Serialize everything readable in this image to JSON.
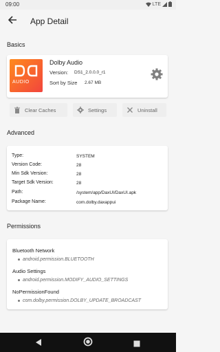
{
  "status": {
    "time": "09:00",
    "network": "LTE"
  },
  "toolbar": {
    "title": "App Detail"
  },
  "basics": {
    "section_title": "Basics",
    "app_name": "Dolby Audio",
    "version_label": "Version:",
    "version_value": "DS1_2.0.0.0_r1",
    "sort_label": "Sort by Size",
    "size_value": "2.67 MB",
    "icon_text": "AUDIO"
  },
  "actions": {
    "clear_caches": "Clear Caches",
    "settings": "Settings",
    "uninstall": "Uninstall"
  },
  "advanced": {
    "section_title": "Advanced",
    "rows": [
      {
        "label": "Type:",
        "value": "SYSTEM"
      },
      {
        "label": "Version Code:",
        "value": "28"
      },
      {
        "label": "Min Sdk Version:",
        "value": "28"
      },
      {
        "label": "Target Sdk Version:",
        "value": "28"
      },
      {
        "label": "Path:",
        "value": "/system/app/DaxUI/DaxUI.apk"
      },
      {
        "label": "Package Name:",
        "value": "com.dolby.daxappui"
      }
    ]
  },
  "permissions": {
    "section_title": "Permissions",
    "groups": [
      {
        "title": "Bluetooth Network",
        "item": "android.permission.BLUETOOTH"
      },
      {
        "title": "Audio Settings",
        "item": "android.permission.MODIFY_AUDIO_SETTINGS"
      },
      {
        "title": "NoPermissionFound",
        "item": "com.dolby.permission.DOLBY_UPDATE_BROADCAST"
      }
    ]
  },
  "colors": {
    "icon_gradient_start": "#ff8a1d",
    "icon_gradient_end": "#f2453d",
    "navbar": "#111111"
  }
}
